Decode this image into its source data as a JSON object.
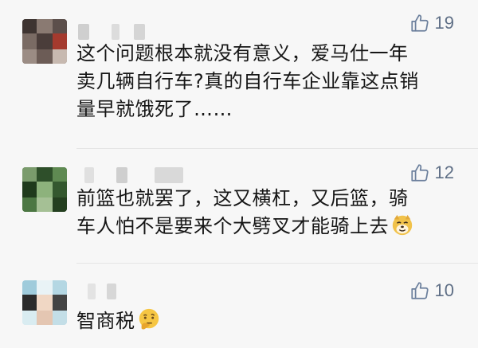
{
  "comments": [
    {
      "likes": "19",
      "lines": [
        "这个问题根本就没有意义，爱马仕一年",
        "卖几辆自行车?真的自行车企业靠这点销",
        "量早就饿死了……"
      ],
      "emoji": ""
    },
    {
      "likes": "12",
      "lines": [
        "前篮也就罢了，这又横杠，又后篮，骑",
        "车人怕不是要来个大劈叉才能骑上去"
      ],
      "emoji": "doge-emoji"
    },
    {
      "likes": "10",
      "lines": [
        "智商税"
      ],
      "emoji": "thinking-emoji"
    }
  ],
  "icons": {
    "like": "thumbs-up-icon"
  },
  "colors": {
    "like": "#6b7f9c",
    "text": "#161616",
    "background": "#f7f7f7"
  }
}
